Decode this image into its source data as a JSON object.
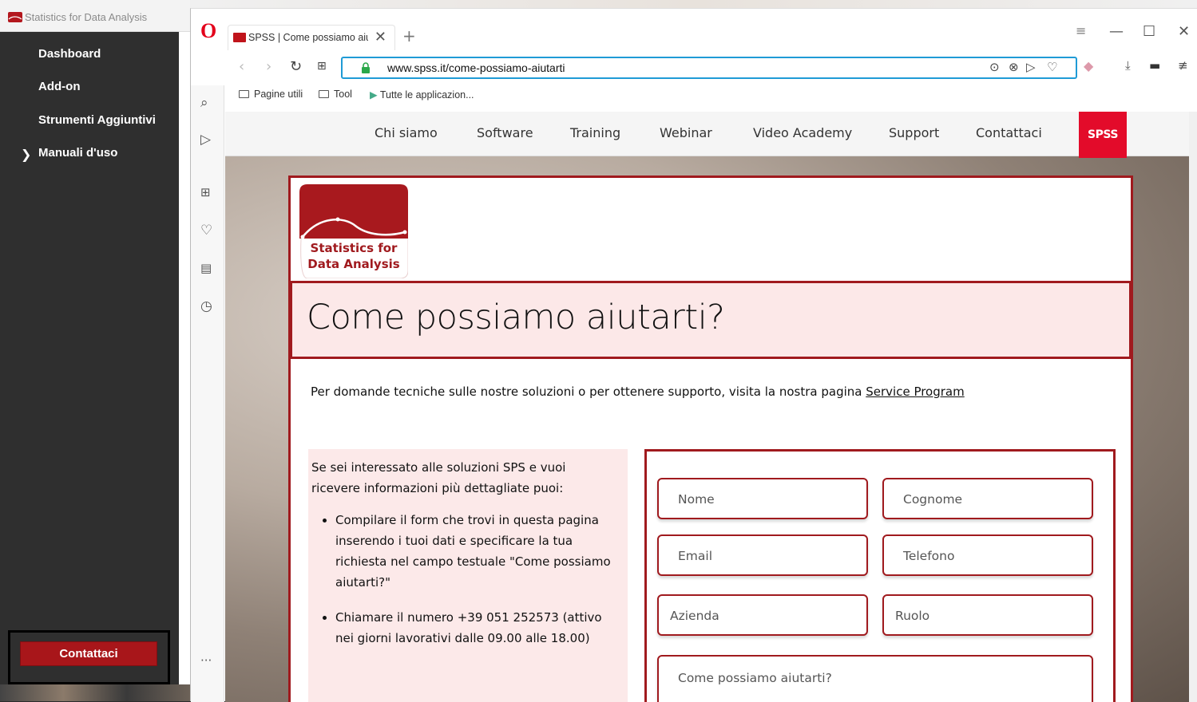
{
  "app": {
    "title": "Statistics for Data Analysis",
    "nav": [
      {
        "label": "Dashboard"
      },
      {
        "label": "Add-on"
      },
      {
        "label": "Strumenti Aggiuntivi"
      },
      {
        "label": "Manuali d'uso"
      }
    ],
    "contact_button": "Contattaci"
  },
  "browser": {
    "tab_title": "SPSS | Come possiamo aiutarti",
    "url": "www.spss.it/come-possiamo-aiutarti",
    "bookmarks": [
      "Pagine utili",
      "Tool",
      "Tutte le applicazion..."
    ]
  },
  "site": {
    "nav": [
      "Chi siamo",
      "Software",
      "Training",
      "Webinar",
      "Video Academy",
      "Support",
      "Contattaci"
    ],
    "badge": "SPSS",
    "logo_line1": "Statistics for",
    "logo_line2": "Data Analysis",
    "heading": "Come possiamo aiutarti?",
    "intro_text": "Per domande tecniche sulle nostre soluzioni o per ottenere supporto, visita la nostra pagina ",
    "intro_link": "Service Program",
    "info_intro": "Se sei interessato alle soluzioni SPS e vuoi ricevere informazioni più dettagliate puoi:",
    "info_items": [
      "Compilare il form che trovi in questa pagina inserendo i tuoi dati e specificare la tua richiesta nel campo testuale \"Come possiamo aiutarti?\"",
      "Chiamare il numero +39 051 252573 (attivo nei giorni lavorativi dalle 09.00 alle 18.00)"
    ],
    "form": {
      "nome": "Nome",
      "cognome": "Cognome",
      "email": "Email",
      "telefono": "Telefono",
      "azienda": "Azienda",
      "ruolo": "Ruolo",
      "messaggio": "Come possiamo aiutarti?"
    }
  },
  "colors": {
    "brand": "#a01a1e",
    "spss_red": "#e30b2a",
    "addr_focus": "#1f9bd6"
  }
}
